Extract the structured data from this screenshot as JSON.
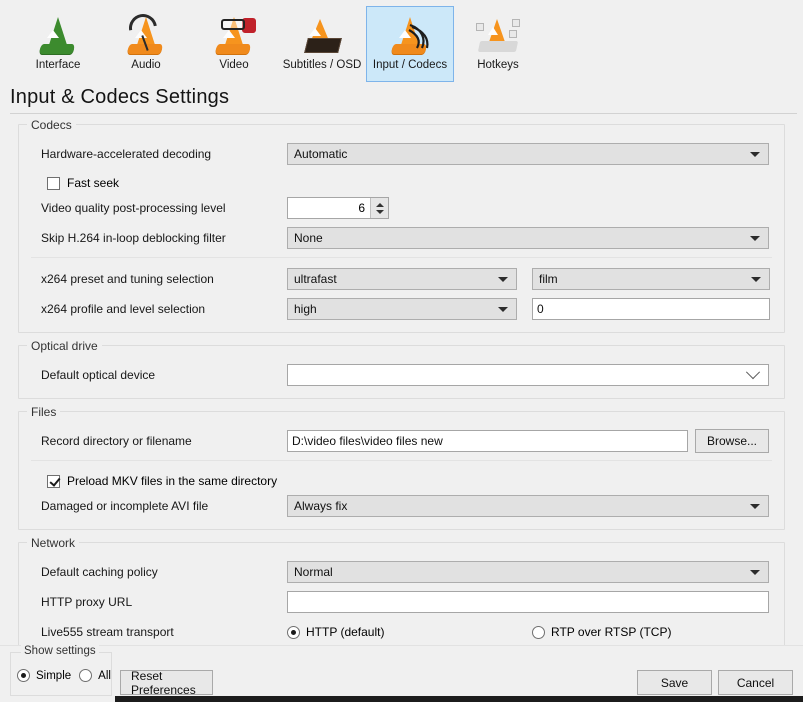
{
  "toolbar": {
    "tabs": [
      {
        "label": "Interface",
        "icon": "vlc-cone-green-icon",
        "selected": false
      },
      {
        "label": "Audio",
        "icon": "vlc-cone-headphones-icon",
        "selected": false
      },
      {
        "label": "Video",
        "icon": "vlc-cone-glasses-icon",
        "selected": false
      },
      {
        "label": "Subtitles / OSD",
        "icon": "vlc-cone-screen-icon",
        "selected": false
      },
      {
        "label": "Input / Codecs",
        "icon": "vlc-cone-cables-icon",
        "selected": true
      },
      {
        "label": "Hotkeys",
        "icon": "vlc-cone-keyboard-icon",
        "selected": false
      }
    ]
  },
  "page": {
    "title": "Input & Codecs Settings"
  },
  "codecs": {
    "title": "Codecs",
    "hardware_decoding_label": "Hardware-accelerated decoding",
    "hardware_decoding_value": "Automatic",
    "fast_seek_label": "Fast seek",
    "fast_seek_checked": false,
    "postproc_label": "Video quality post-processing level",
    "postproc_value": "6",
    "skip_loop_label": "Skip H.264 in-loop deblocking filter",
    "skip_loop_value": "None",
    "x264_preset_label": "x264 preset and tuning selection",
    "x264_preset_value": "ultrafast",
    "x264_tuning_value": "film",
    "x264_profile_label": "x264 profile and level selection",
    "x264_profile_value": "high",
    "x264_level_value": "0"
  },
  "optical": {
    "title": "Optical drive",
    "default_device_label": "Default optical device",
    "default_device_value": ""
  },
  "files": {
    "title": "Files",
    "record_dir_label": "Record directory or filename",
    "record_dir_value": "D:\\video files\\video files new",
    "browse_label": "Browse...",
    "preload_mkv_label": "Preload MKV files in the same directory",
    "preload_mkv_checked": true,
    "avi_label": "Damaged or incomplete AVI file",
    "avi_value": "Always fix"
  },
  "network": {
    "title": "Network",
    "caching_label": "Default caching policy",
    "caching_value": "Normal",
    "proxy_label": "HTTP proxy URL",
    "proxy_value": "",
    "live555_label": "Live555 stream transport",
    "option_http": "HTTP (default)",
    "option_rtp": "RTP over RTSP (TCP)",
    "selected_transport": "HTTP (default)"
  },
  "footer": {
    "show_settings_title": "Show settings",
    "simple_label": "Simple",
    "all_label": "All",
    "selected_mode": "Simple",
    "reset_label": "Reset Preferences",
    "save_label": "Save",
    "cancel_label": "Cancel"
  }
}
